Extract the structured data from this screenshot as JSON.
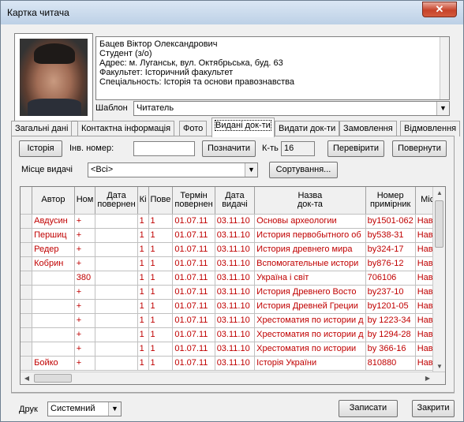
{
  "window": {
    "title": "Картка читача",
    "close_icon": "✕"
  },
  "info": {
    "lines": [
      "Бацев Віктор Олександрович",
      "Студент (з/о)",
      "Адрес: м. Луганськ, вул. Октябрьська, буд. 63",
      "Факультет: Історичний факультет",
      "Спеціальность: Історія та основи правознавства"
    ]
  },
  "template": {
    "label": "Шаблон",
    "value": "Читатель"
  },
  "tabs": [
    "Загальні дані",
    "Контактна інформація",
    "Фото",
    "Видані док-ти",
    "Видати док-ти",
    "Замовлення",
    "Відмовлення"
  ],
  "active_tab": 3,
  "toolbar": {
    "history_button": "Історія",
    "inv_label": "Інв. номер:",
    "inv_value": "",
    "mark_button": "Позначити",
    "count_label": "К-ть",
    "count_value": "16",
    "check_button": "Перевірити",
    "return_button": "Повернути",
    "place_label": "Місце видачі",
    "place_value": "<Всі>",
    "sort_button": "Сортування..."
  },
  "table": {
    "headers": [
      "",
      "Автор",
      "Ном",
      "Дата\nповернен",
      "Кі",
      "Пове",
      "Термін\nповернен",
      "Дата\nвидачі",
      "Назва\nдок-та",
      "Номер\nпримірник",
      "Місц"
    ],
    "rows": [
      [
        "",
        "Авдусин",
        "+",
        "",
        "1",
        "1",
        "01.07.11",
        "03.11.10",
        "Основы археологии",
        "by1501-062",
        "Навча"
      ],
      [
        "",
        "Першиц",
        "+",
        "",
        "1",
        "1",
        "01.07.11",
        "03.11.10",
        "История первобытного об",
        "by538-31",
        "Навча"
      ],
      [
        "",
        "Редер",
        "+",
        "",
        "1",
        "1",
        "01.07.11",
        "03.11.10",
        "История древнего мира",
        "by324-17",
        "Навча"
      ],
      [
        "",
        "Кобрин",
        "+",
        "",
        "1",
        "1",
        "01.07.11",
        "03.11.10",
        "Вспомогательные истори",
        "by876-12",
        "Навча"
      ],
      [
        "",
        "",
        "380",
        "",
        "1",
        "1",
        "01.07.11",
        "03.11.10",
        "Україна і світ",
        "706106",
        "Навча"
      ],
      [
        "",
        "",
        "+",
        "",
        "1",
        "1",
        "01.07.11",
        "03.11.10",
        "История Древнего Восто",
        "by237-10",
        "Навча"
      ],
      [
        "",
        "",
        "+",
        "",
        "1",
        "1",
        "01.07.11",
        "03.11.10",
        "История Древней Греции",
        "by1201-05",
        "Навча"
      ],
      [
        "",
        "",
        "+",
        "",
        "1",
        "1",
        "01.07.11",
        "03.11.10",
        "Хрестоматия по истории д",
        "by 1223-34",
        "Навча"
      ],
      [
        "",
        "",
        "+",
        "",
        "1",
        "1",
        "01.07.11",
        "03.11.10",
        "Хрестоматия по истории д",
        "by 1294-28",
        "Навча"
      ],
      [
        "",
        "",
        "+",
        "",
        "1",
        "1",
        "01.07.11",
        "03.11.10",
        "Хрестоматия по истории",
        "by 366-16",
        "Навча"
      ],
      [
        "",
        "Бойко",
        "+",
        "",
        "1",
        "1",
        "01.07.11",
        "03.11.10",
        "Історія України",
        "810880",
        "Навча"
      ]
    ]
  },
  "footer": {
    "print_label": "Друк",
    "print_value": "Системний",
    "save_button": "Записати",
    "close_button": "Закрити"
  }
}
